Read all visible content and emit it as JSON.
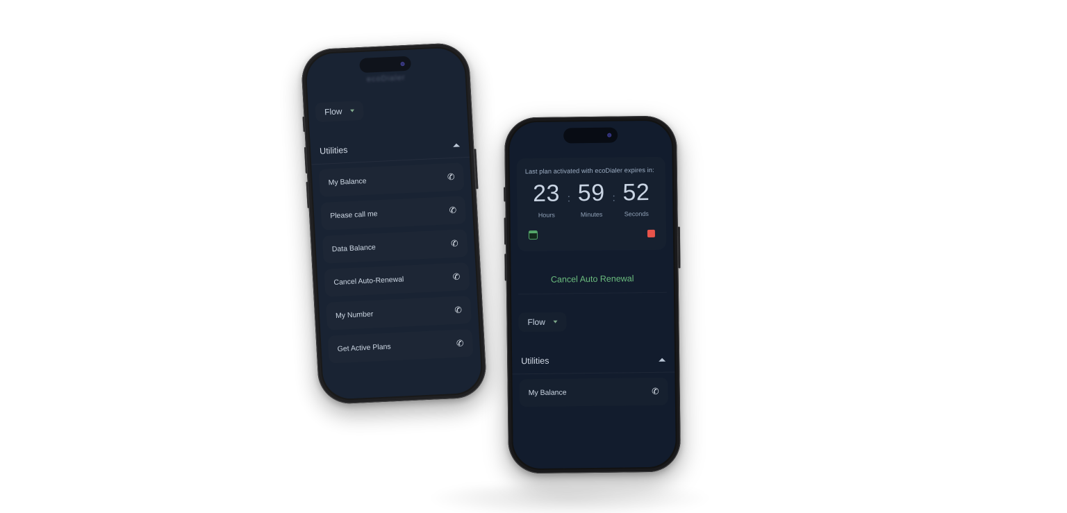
{
  "page": {
    "background_color": "#ffffff",
    "device_count": 2
  },
  "theme": {
    "screen_bg": "#121c2d",
    "card_bg": "#16202f",
    "text_primary": "#cdd7e4",
    "text_secondary": "#9fb0c6",
    "accent_green": "#6bbd7e",
    "accent_red": "#e8534a",
    "frame_color": "#121212"
  },
  "phone_left": {
    "device_name": "iphone-tilted-left",
    "status_blur_text": "ecoDialer",
    "flow": {
      "label": "Flow",
      "caret_icon": "chevron-down-icon"
    },
    "section": {
      "title": "Utilities",
      "toggle_icon": "chevron-up-icon"
    },
    "items": [
      {
        "label": "My Balance",
        "action_icon": "phone-call-icon",
        "glyph": "✆"
      },
      {
        "label": "Please call me",
        "action_icon": "phone-call-icon",
        "glyph": "✆"
      },
      {
        "label": "Data Balance",
        "action_icon": "phone-call-icon",
        "glyph": "✆"
      },
      {
        "label": "Cancel Auto-Renewal",
        "action_icon": "phone-call-icon",
        "glyph": "✆"
      },
      {
        "label": "My Number",
        "action_icon": "phone-call-icon",
        "glyph": "✆"
      },
      {
        "label": "Get Active Plans",
        "action_icon": "phone-call-icon",
        "glyph": "✆"
      }
    ]
  },
  "phone_right": {
    "device_name": "iphone-front",
    "countdown": {
      "label": "Last plan activated with ecoDialer expires in:",
      "separator": ":",
      "units": [
        {
          "value": "23",
          "name": "Hours"
        },
        {
          "value": "59",
          "name": "Minutes"
        },
        {
          "value": "52",
          "name": "Seconds"
        }
      ],
      "calendar_icon": "calendar-icon",
      "stop_icon": "stop-square-icon"
    },
    "cancel_button": {
      "label": "Cancel Auto Renewal",
      "color": "#6bbd7e"
    },
    "flow": {
      "label": "Flow",
      "caret_icon": "chevron-down-icon"
    },
    "section": {
      "title": "Utilities",
      "toggle_icon": "chevron-up-icon"
    },
    "items": [
      {
        "label": "My Balance",
        "action_icon": "phone-call-icon",
        "glyph": "✆"
      }
    ]
  }
}
